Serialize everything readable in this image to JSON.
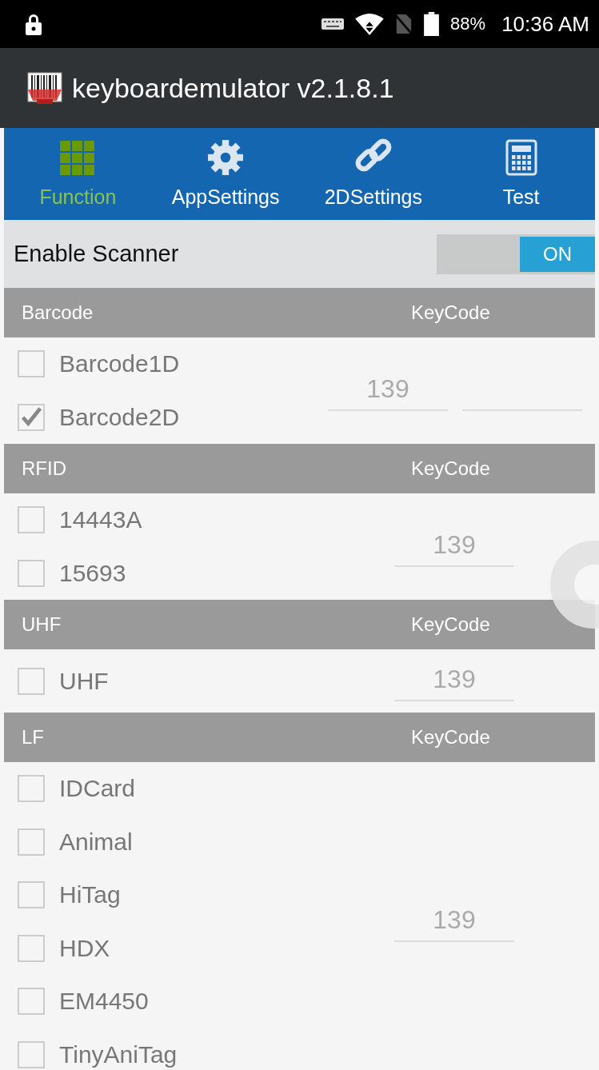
{
  "status_bar": {
    "battery": "88%",
    "time": "10:36 AM"
  },
  "app_bar": {
    "title": "keyboardemulator v2.1.8.1"
  },
  "tabs": [
    {
      "label": "Function",
      "selected": true,
      "kind": "grid"
    },
    {
      "label": "AppSettings",
      "selected": false,
      "kind": "gear"
    },
    {
      "label": "2DSettings",
      "selected": false,
      "kind": "link"
    },
    {
      "label": "Test",
      "selected": false,
      "kind": "calculator"
    }
  ],
  "enable_scanner": {
    "label": "Enable Scanner",
    "on": true,
    "toggle_text": "ON"
  },
  "sections": [
    {
      "title": "Barcode",
      "keycode_label": "KeyCode",
      "items": [
        {
          "label": "Barcode1D",
          "checked": false
        },
        {
          "label": "Barcode2D",
          "checked": true
        }
      ],
      "fields": [
        {
          "kind": "filled",
          "value": "139"
        },
        {
          "kind": "empty"
        }
      ]
    },
    {
      "title": "RFID",
      "keycode_label": "KeyCode",
      "items": [
        {
          "label": "14443A",
          "checked": false
        },
        {
          "label": "15693",
          "checked": false
        }
      ],
      "fields": [
        {
          "kind": "filled",
          "value": "139"
        }
      ]
    },
    {
      "title": "UHF",
      "keycode_label": "KeyCode",
      "items": [
        {
          "label": "UHF",
          "checked": false
        }
      ],
      "fields": [
        {
          "kind": "filled",
          "value": "139"
        }
      ]
    },
    {
      "title": "LF",
      "keycode_label": "KeyCode",
      "items": [
        {
          "label": "IDCard",
          "checked": false
        },
        {
          "label": "Animal",
          "checked": false
        },
        {
          "label": "HiTag",
          "checked": false
        },
        {
          "label": "HDX",
          "checked": false
        },
        {
          "label": "EM4450",
          "checked": false
        },
        {
          "label": "TinyAniTag",
          "checked": false
        }
      ],
      "fields": [
        {
          "kind": "filled",
          "value": "139"
        }
      ]
    }
  ]
}
